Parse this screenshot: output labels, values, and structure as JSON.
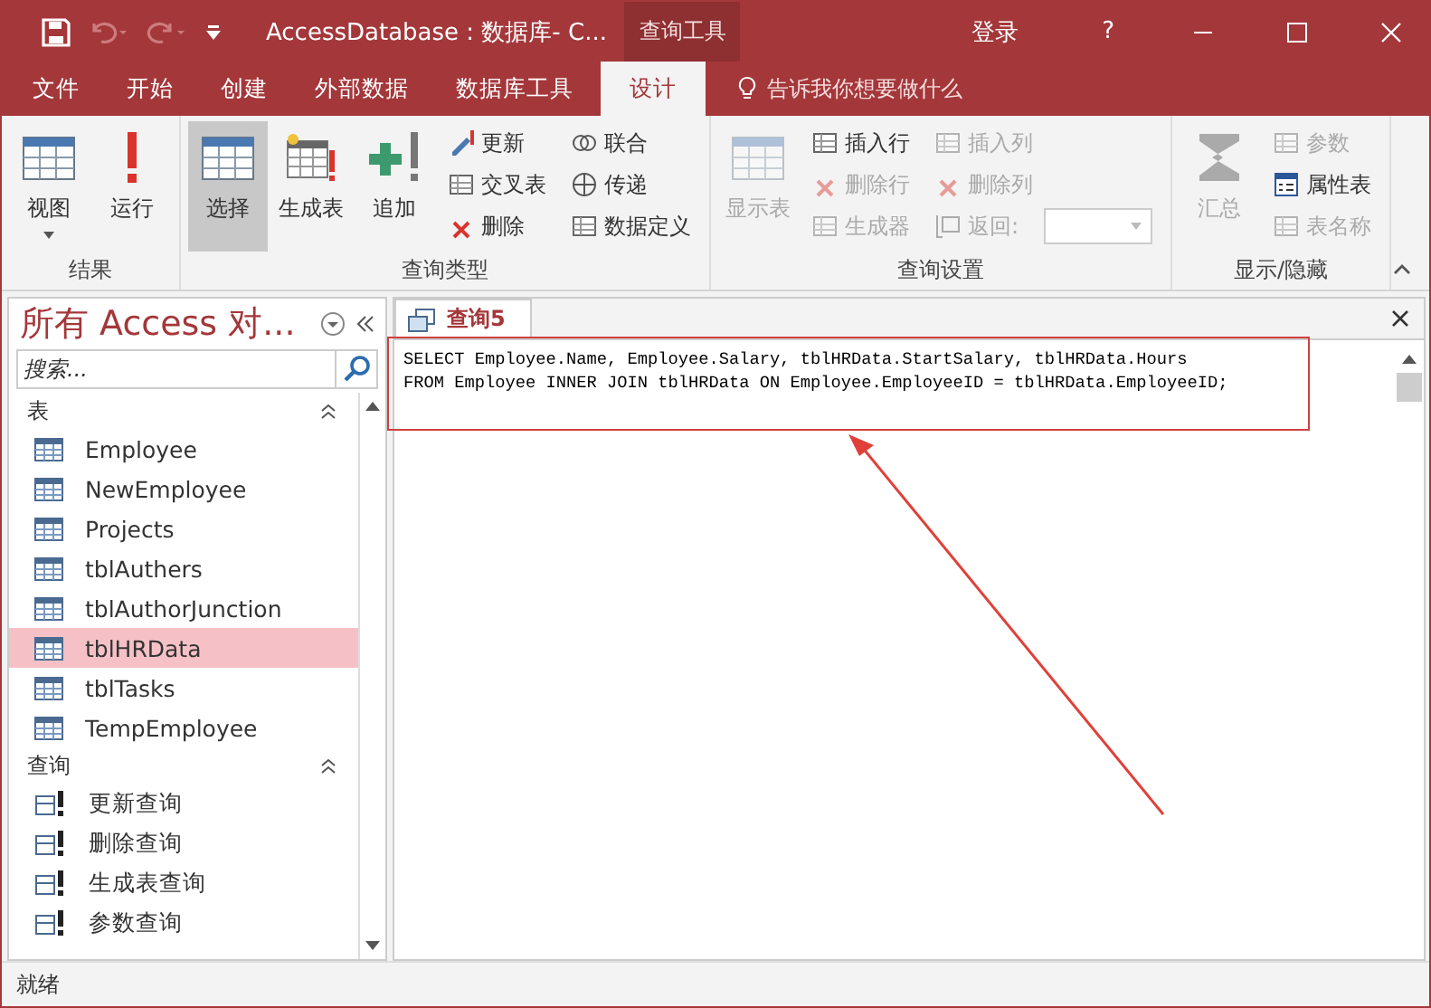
{
  "title_bar": {
    "title": "AccessDatabase : 数据库- C...",
    "context_tab": "查询工具",
    "sign_in": "登录",
    "help": "?"
  },
  "menu_tabs": [
    {
      "label": "文件",
      "selected": false
    },
    {
      "label": "开始",
      "selected": false
    },
    {
      "label": "创建",
      "selected": false
    },
    {
      "label": "外部数据",
      "selected": false
    },
    {
      "label": "数据库工具",
      "selected": false
    },
    {
      "label": "设计",
      "selected": true
    }
  ],
  "tell_me": "告诉我你想要做什么",
  "ribbon_groups": [
    {
      "label": "结果",
      "items": [
        {
          "kind": "large",
          "label": "视图",
          "disabled": false,
          "selected": false,
          "dropdown": true
        },
        {
          "kind": "large",
          "label": "运行",
          "disabled": false,
          "selected": false,
          "dropdown": false
        }
      ]
    },
    {
      "label": "查询类型",
      "items": [
        {
          "kind": "large",
          "label": "选择",
          "disabled": false,
          "selected": true,
          "dropdown": false
        },
        {
          "kind": "large",
          "label": "生成表",
          "disabled": false,
          "selected": false,
          "dropdown": false
        },
        {
          "kind": "large",
          "label": "追加",
          "disabled": false,
          "selected": false,
          "dropdown": false
        },
        {
          "kind": "small",
          "label": "更新",
          "disabled": false
        },
        {
          "kind": "small",
          "label": "交叉表",
          "disabled": false
        },
        {
          "kind": "small",
          "label": "删除",
          "disabled": false
        },
        {
          "kind": "small",
          "label": "联合",
          "disabled": false
        },
        {
          "kind": "small",
          "label": "传递",
          "disabled": false
        },
        {
          "kind": "small",
          "label": "数据定义",
          "disabled": false
        }
      ]
    },
    {
      "label": "查询设置",
      "items": [
        {
          "kind": "large",
          "label": "显示表",
          "disabled": true,
          "selected": false,
          "dropdown": false
        },
        {
          "kind": "small",
          "label": "插入行",
          "disabled": false
        },
        {
          "kind": "small",
          "label": "删除行",
          "disabled": true
        },
        {
          "kind": "small",
          "label": "生成器",
          "disabled": true
        },
        {
          "kind": "small",
          "label": "插入列",
          "disabled": true
        },
        {
          "kind": "small",
          "label": "删除列",
          "disabled": true
        },
        {
          "kind": "combo",
          "label": "返回:",
          "disabled": true
        }
      ]
    },
    {
      "label": "显示/隐藏",
      "items": [
        {
          "kind": "large",
          "label": "汇总",
          "disabled": true,
          "selected": false,
          "dropdown": false
        },
        {
          "kind": "small",
          "label": "参数",
          "disabled": true
        },
        {
          "kind": "small",
          "label": "属性表",
          "disabled": false
        },
        {
          "kind": "small",
          "label": "表名称",
          "disabled": true
        }
      ]
    }
  ],
  "nav_pane": {
    "title": "所有 Access 对...",
    "search_placeholder": "搜索...",
    "sections": [
      {
        "label": "表",
        "kind": "table",
        "items": [
          {
            "label": "Employee",
            "selected": false
          },
          {
            "label": "NewEmployee",
            "selected": false
          },
          {
            "label": "Projects",
            "selected": false
          },
          {
            "label": "tblAuthers",
            "selected": false
          },
          {
            "label": "tblAuthorJunction",
            "selected": false
          },
          {
            "label": "tblHRData",
            "selected": true
          },
          {
            "label": "tblTasks",
            "selected": false
          },
          {
            "label": "TempEmployee",
            "selected": false
          }
        ]
      },
      {
        "label": "查询",
        "kind": "query",
        "items": [
          {
            "label": "更新查询",
            "selected": false
          },
          {
            "label": "删除查询",
            "selected": false
          },
          {
            "label": "生成表查询",
            "selected": false
          },
          {
            "label": "参数查询",
            "selected": false
          }
        ]
      }
    ]
  },
  "document": {
    "tab": {
      "label": "查询5",
      "selected": true
    },
    "sql_lines": [
      "SELECT Employee.Name, Employee.Salary, tblHRData.StartSalary, tblHRData.Hours",
      "FROM Employee INNER JOIN tblHRData ON Employee.EmployeeID = tblHRData.EmployeeID;"
    ]
  },
  "status_bar": "就绪"
}
